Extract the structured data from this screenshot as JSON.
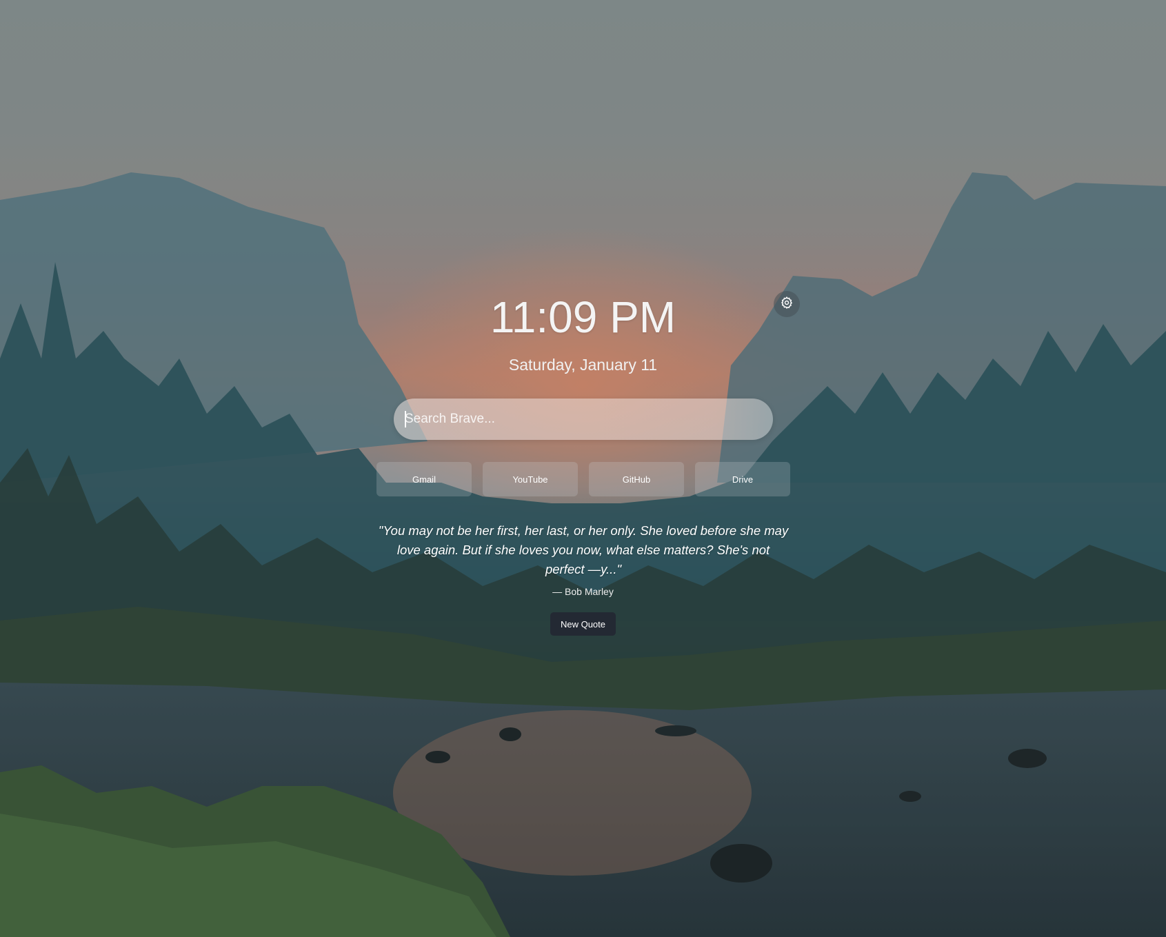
{
  "clock": {
    "time": "11:09 PM",
    "date": "Saturday, January 11"
  },
  "settings": {
    "icon": "gear-icon"
  },
  "search": {
    "placeholder": "Search Brave..."
  },
  "shortcuts": [
    {
      "label": "Gmail"
    },
    {
      "label": "YouTube"
    },
    {
      "label": "GitHub"
    },
    {
      "label": "Drive"
    }
  ],
  "quote": {
    "text": "\"You may not be her first, her last, or her only. She loved before she may love again. But if she loves you now, what else matters? She's not perfect —y...\"",
    "author": "— Bob Marley",
    "new_quote_label": "New Quote"
  },
  "background": {
    "description_icon": "landscape-wallpaper"
  },
  "colors": {
    "button_dark": "#232933",
    "text": "#ffffff"
  }
}
